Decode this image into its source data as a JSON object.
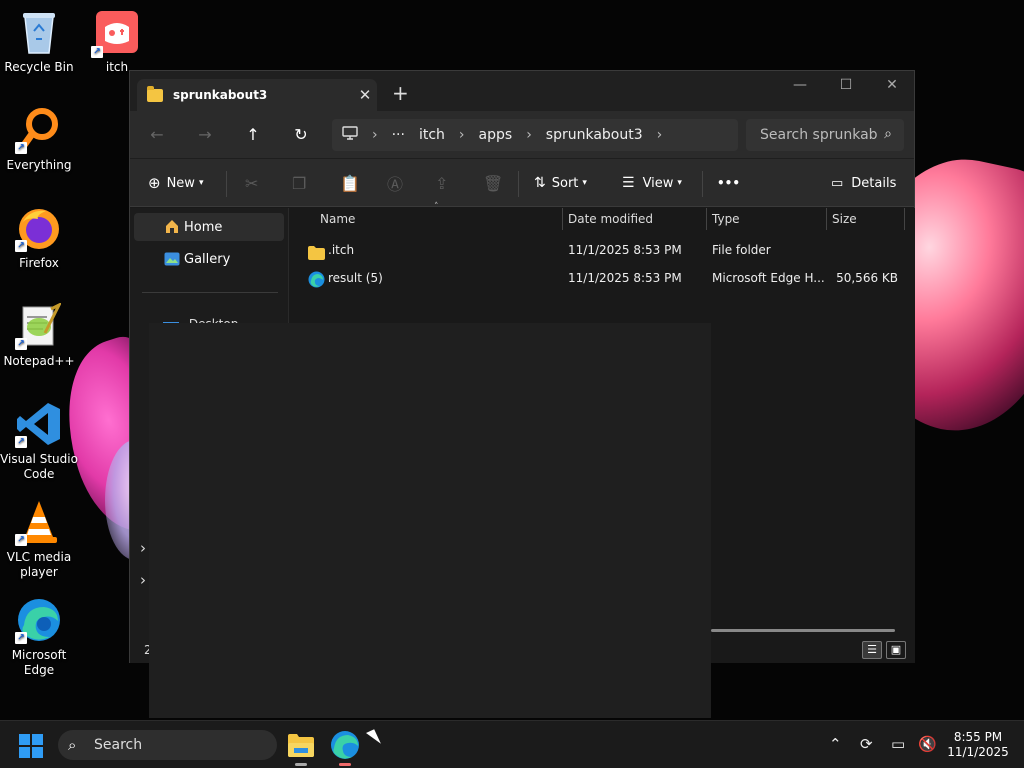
{
  "desktop": {
    "icons": [
      {
        "label": "Recycle Bin"
      },
      {
        "label": "itch"
      },
      {
        "label": "Everything"
      },
      {
        "label": "Firefox"
      },
      {
        "label": "Notepad++"
      },
      {
        "label": "Visual Studio Code"
      },
      {
        "label": "VLC media player"
      },
      {
        "label": "Microsoft Edge"
      }
    ]
  },
  "window": {
    "tab_title": "sprunkabout3",
    "tab_close": "✕",
    "new_tab": "+",
    "controls": {
      "minimize": "—",
      "maximize": "☐",
      "close": "✕"
    },
    "nav": {
      "back": "←",
      "forward": "→",
      "up": "↑",
      "refresh": "↻"
    },
    "address": {
      "overflow": "···",
      "crumbs": [
        "itch",
        "apps",
        "sprunkabout3"
      ]
    },
    "search_placeholder": "Search sprunkab",
    "toolbar": {
      "new_label": "New",
      "sort_label": "Sort",
      "view_label": "View",
      "more_label": "•••",
      "details_label": "Details"
    },
    "nav_pane": {
      "items": [
        {
          "label": "Home"
        },
        {
          "label": "Gallery"
        }
      ],
      "peek_label": "Desktop"
    },
    "columns": [
      "Name",
      "Date modified",
      "Type",
      "Size"
    ],
    "rows": [
      {
        "name": ".itch",
        "date": "11/1/2025 8:53 PM",
        "type": "File folder",
        "size": ""
      },
      {
        "name": "result (5)",
        "date": "11/1/2025 8:53 PM",
        "type": "Microsoft Edge H...",
        "size": "50,566 KB"
      }
    ],
    "status_text": "2"
  },
  "taskbar": {
    "search_label": "Search",
    "time": "8:55 PM",
    "date": "11/1/2025"
  },
  "colors": {
    "accent": "#2f9cf5",
    "folder": "#f4c542",
    "window_bg": "#191919",
    "toolbar_bg": "#2b2b2b"
  }
}
